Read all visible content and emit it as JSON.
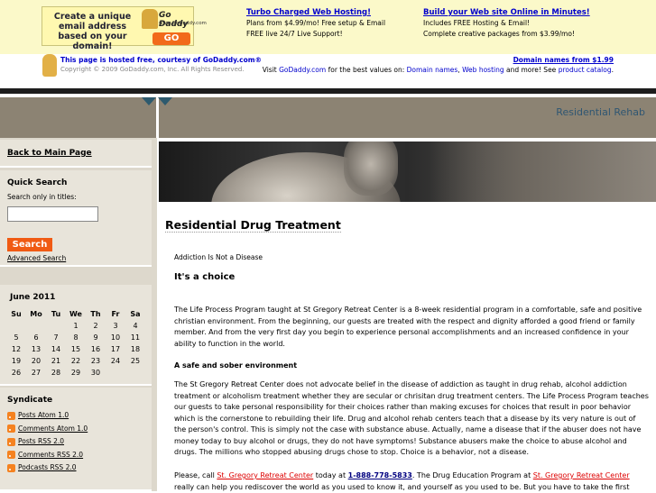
{
  "adbar": {
    "banner": {
      "text": "Create a unique email address based on your domain!",
      "logo_name": "Go Daddy",
      "logo_url": "www.GoDaddy.com",
      "go_label": "GO"
    },
    "col1": {
      "head": "Turbo Charged Web Hosting!",
      "line1": "Plans from $4.99/mo! Free setup & Email",
      "line2": "FREE live 24/7 Live Support!"
    },
    "col2": {
      "head": "Build your Web site Online in Minutes!",
      "line1": "Includes FREE Hosting & Email!",
      "line2": "Complete creative packages from $3.99/mo!"
    }
  },
  "hosted": {
    "line1_prefix": "This page is hosted free, courtesy of ",
    "line1_link": "GoDaddy.com",
    "line1_suffix": "®",
    "copyright": "Copyright © 2009 GoDaddy.com, Inc. All Rights Reserved.",
    "right_link": "Domain names from $1.99",
    "visit_prefix": "Visit ",
    "visit_link": "GoDaddy.com",
    "visit_mid": " for the best values on: ",
    "domain_link": "Domain names",
    "comma": ", ",
    "hosting_link": "Web hosting",
    "and_more": " and more! See ",
    "catalog_link": "product catalog",
    "period": "."
  },
  "header": {
    "site_title": "Residential Rehab"
  },
  "sidebar": {
    "back_link": "Back to Main Page",
    "search_title": "Quick Search",
    "search_label": "Search only in titles:",
    "search_value": "",
    "search_button": "Search",
    "advanced_search": "Advanced Search",
    "calendar": {
      "title": "June 2011",
      "days": [
        "Su",
        "Mo",
        "Tu",
        "We",
        "Th",
        "Fr",
        "Sa"
      ],
      "weeks": [
        [
          "",
          "",
          "",
          "1",
          "2",
          "3",
          "4"
        ],
        [
          "5",
          "6",
          "7",
          "8",
          "9",
          "10",
          "11"
        ],
        [
          "12",
          "13",
          "14",
          "15",
          "16",
          "17",
          "18"
        ],
        [
          "19",
          "20",
          "21",
          "22",
          "23",
          "24",
          "25"
        ],
        [
          "26",
          "27",
          "28",
          "29",
          "30",
          "",
          ""
        ]
      ]
    },
    "syndicate_title": "Syndicate",
    "syndicate": [
      {
        "label": "Posts Atom 1.0",
        "icon": "rss-feed-icon"
      },
      {
        "label": "Comments Atom 1.0",
        "icon": "rss-feed-icon"
      },
      {
        "label": "Posts RSS 2.0",
        "icon": "rss-feed-icon"
      },
      {
        "label": "Comments RSS 2.0",
        "icon": "rss-feed-icon"
      },
      {
        "label": "Podcasts RSS 2.0",
        "icon": "rss-feed-icon"
      }
    ]
  },
  "post": {
    "title": "Residential Drug Treatment",
    "subtitle": "Addiction Is Not a Disease",
    "heading1": "It's a choice",
    "para1": "The Life Process Program taught at St Gregory Retreat Center is a 8-week residential program in a comfortable, safe and positive christian environment. From the beginning, our guests are treated with the respect and dignity afforded a good friend or family member. And from the very first day you begin to experience personal accomplishments and an increased confidence in your ability to function in the world.",
    "heading2": "A safe and sober environment",
    "para2": "The St Gregory Retreat Center does not advocate belief in the disease of addiction as taught in drug rehab, alcohol addiction treatment or alcoholism treatment whether they are secular or chrisitan drug treatment centers. The Life Process Program teaches our guests to take personal responsibility for their choices rather than making excuses for choices that result in poor behavior which is the cornerstone to rebuilding their life. Drug and alcohol rehab centers teach that a disease by its very nature is out of the person's control. This is simply not the case with substance abuse. Actually, name a disease that if the abuser does not have money today to buy alcohol or drugs, they do not have symptoms! Substance abusers make the choice to abuse alcohol and drugs. The millions who stopped abusing drugs chose to stop. Choice is a behavior, not a disease.",
    "para3_a": "Please, call ",
    "para3_link1": "St. Gregory Retreat Center",
    "para3_b": " today at ",
    "para3_phone": "1-888-778-5833",
    "para3_c": ". The Drug Education Program at ",
    "para3_link2": "St. Gregory Retreat Center",
    "para3_d": " really can help you rediscover the world as you used to know it, and yourself as you used to be. But you have to take the first"
  },
  "colors": {
    "ad_background": "#fbf9c9",
    "header_background": "#8c8373",
    "site_title_color": "#2f5672",
    "sidebar_background": "#e8e4da",
    "search_button": "#f05a13",
    "link_red": "#dd0000"
  }
}
